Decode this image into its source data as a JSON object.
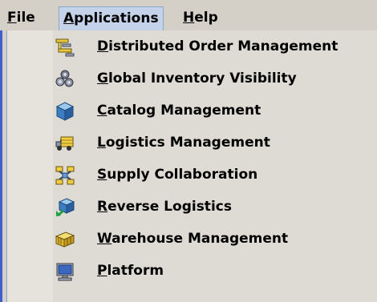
{
  "menubar": {
    "file": {
      "mnemonic": "F",
      "rest": "ile"
    },
    "applications": {
      "mnemonic": "A",
      "rest": "pplications"
    },
    "help": {
      "mnemonic": "H",
      "rest": "elp"
    }
  },
  "applications_menu": {
    "items": [
      {
        "mnemonic": "D",
        "rest": "istributed Order Management",
        "icon": "order-management-icon"
      },
      {
        "mnemonic": "G",
        "rest": "lobal Inventory Visibility",
        "icon": "inventory-visibility-icon"
      },
      {
        "mnemonic": "C",
        "rest": "atalog Management",
        "icon": "catalog-icon"
      },
      {
        "mnemonic": "L",
        "rest": "ogistics Management",
        "icon": "logistics-truck-icon"
      },
      {
        "mnemonic": "S",
        "rest": "upply Collaboration",
        "icon": "supply-collaboration-icon"
      },
      {
        "mnemonic": "R",
        "rest": "everse Logistics",
        "icon": "reverse-logistics-icon"
      },
      {
        "mnemonic": "W",
        "rest": "arehouse Management",
        "icon": "warehouse-icon"
      },
      {
        "mnemonic": "P",
        "rest": "latform",
        "icon": "platform-monitor-icon"
      }
    ]
  },
  "colors": {
    "menu_background": "#d4d0c8",
    "dropdown_background": "#dedbd5",
    "selected_menu_highlight": "#c4d3ea",
    "left_accent": "#3f5fd0"
  }
}
